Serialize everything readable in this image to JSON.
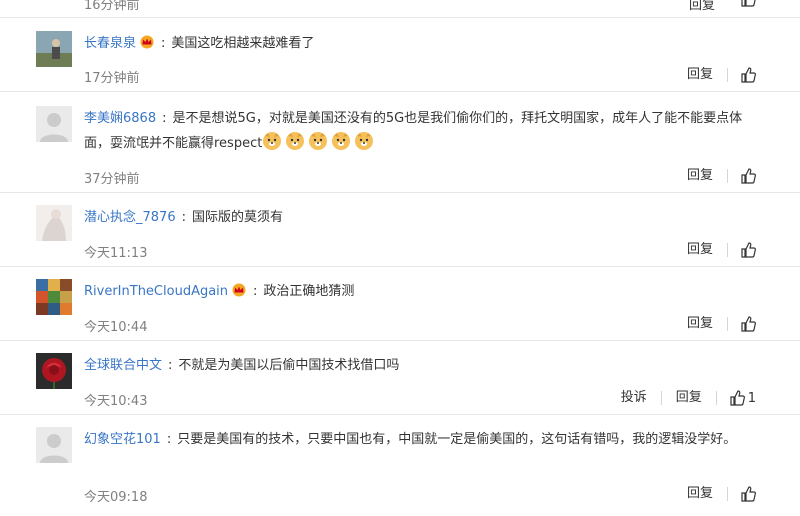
{
  "top_fragment": {
    "time": "16分钟前",
    "reply": "回复"
  },
  "labels": {
    "reply": "回复",
    "report": "投诉"
  },
  "comments": [
    {
      "username": "长春泉泉",
      "vip": true,
      "text": "美国这吃相越来越难看了",
      "time": "17分钟前"
    },
    {
      "username": "李美娴6868",
      "vip": false,
      "text": "是不是想说5G，对就是美国还没有的5G也是我们偷你们的，拜托文明国家，成年人了能不能要点体面，耍流氓并不能赢得respect",
      "emoji_count": 5,
      "time": "37分钟前"
    },
    {
      "username": "潜心执念_7876",
      "vip": false,
      "text": "国际版的莫须有",
      "time": "今天11:13"
    },
    {
      "username": "RiverInTheCloudAgain",
      "vip": true,
      "text": "政治正确地猜测",
      "time": "今天10:44"
    },
    {
      "username": "全球联合中文",
      "vip": false,
      "text": "不就是为美国以后偷中国技术找借口吗",
      "time": "今天10:43",
      "likes": "1"
    },
    {
      "username": "幻象空花101",
      "vip": false,
      "text": "只要是美国有的技术，只要中国也有，中国就一定是偷美国的，这句话有错吗，我的逻辑没学好。",
      "time": "今天09:18"
    }
  ],
  "colors": {
    "username": "#3975c6",
    "time": "#808080",
    "divider": "#e6e6e6",
    "crown": "#f5a623"
  }
}
